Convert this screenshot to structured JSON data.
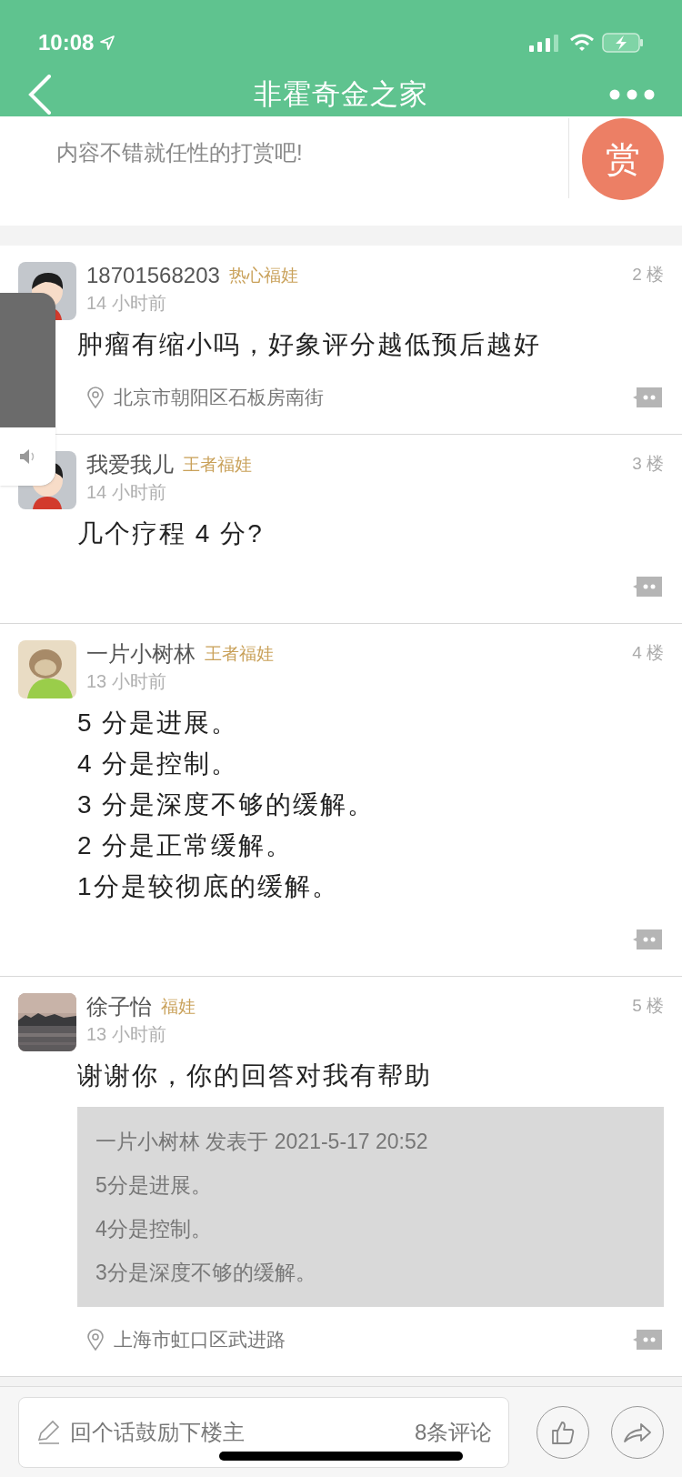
{
  "status_bar": {
    "time": "10:08"
  },
  "nav": {
    "title": "非霍奇金之家"
  },
  "reward": {
    "text": "内容不错就任性的打赏吧!",
    "button": "赏"
  },
  "posts": [
    {
      "avatar": {
        "kind": "figure"
      },
      "user": "18701568203",
      "badge": "热心福娃",
      "time": "14 小时前",
      "floor": "2 楼",
      "content": [
        "肿瘤有缩小吗，好象评分越低预后越好"
      ],
      "location": "北京市朝阳区石板房南街"
    },
    {
      "avatar": {
        "kind": "figure"
      },
      "user": "我爱我儿",
      "badge": "王者福娃",
      "time": "14 小时前",
      "floor": "3 楼",
      "content": [
        "几个疗程 4 分?"
      ]
    },
    {
      "avatar": {
        "kind": "animal"
      },
      "user": "一片小树林",
      "badge": "王者福娃",
      "time": "13 小时前",
      "floor": "4 楼",
      "content": [
        "5 分是进展。",
        "4 分是控制。",
        "3 分是深度不够的缓解。",
        "2 分是正常缓解。",
        "1分是较彻底的缓解。"
      ]
    },
    {
      "avatar": {
        "kind": "picture"
      },
      "user": "徐子怡",
      "badge": "福娃",
      "time": "13 小时前",
      "floor": "5 楼",
      "content": [
        "谢谢你，你的回答对我有帮助"
      ],
      "quote": [
        "一片小树林 发表于 2021-5-17 20:52",
        "5分是进展。",
        "4分是控制。",
        "3分是深度不够的缓解。"
      ],
      "location": "上海市虹口区武进路"
    }
  ],
  "bottom_bar": {
    "placeholder": "回个话鼓励下楼主",
    "comment_count": "8条评论"
  },
  "volume": {
    "level": 0.3
  }
}
